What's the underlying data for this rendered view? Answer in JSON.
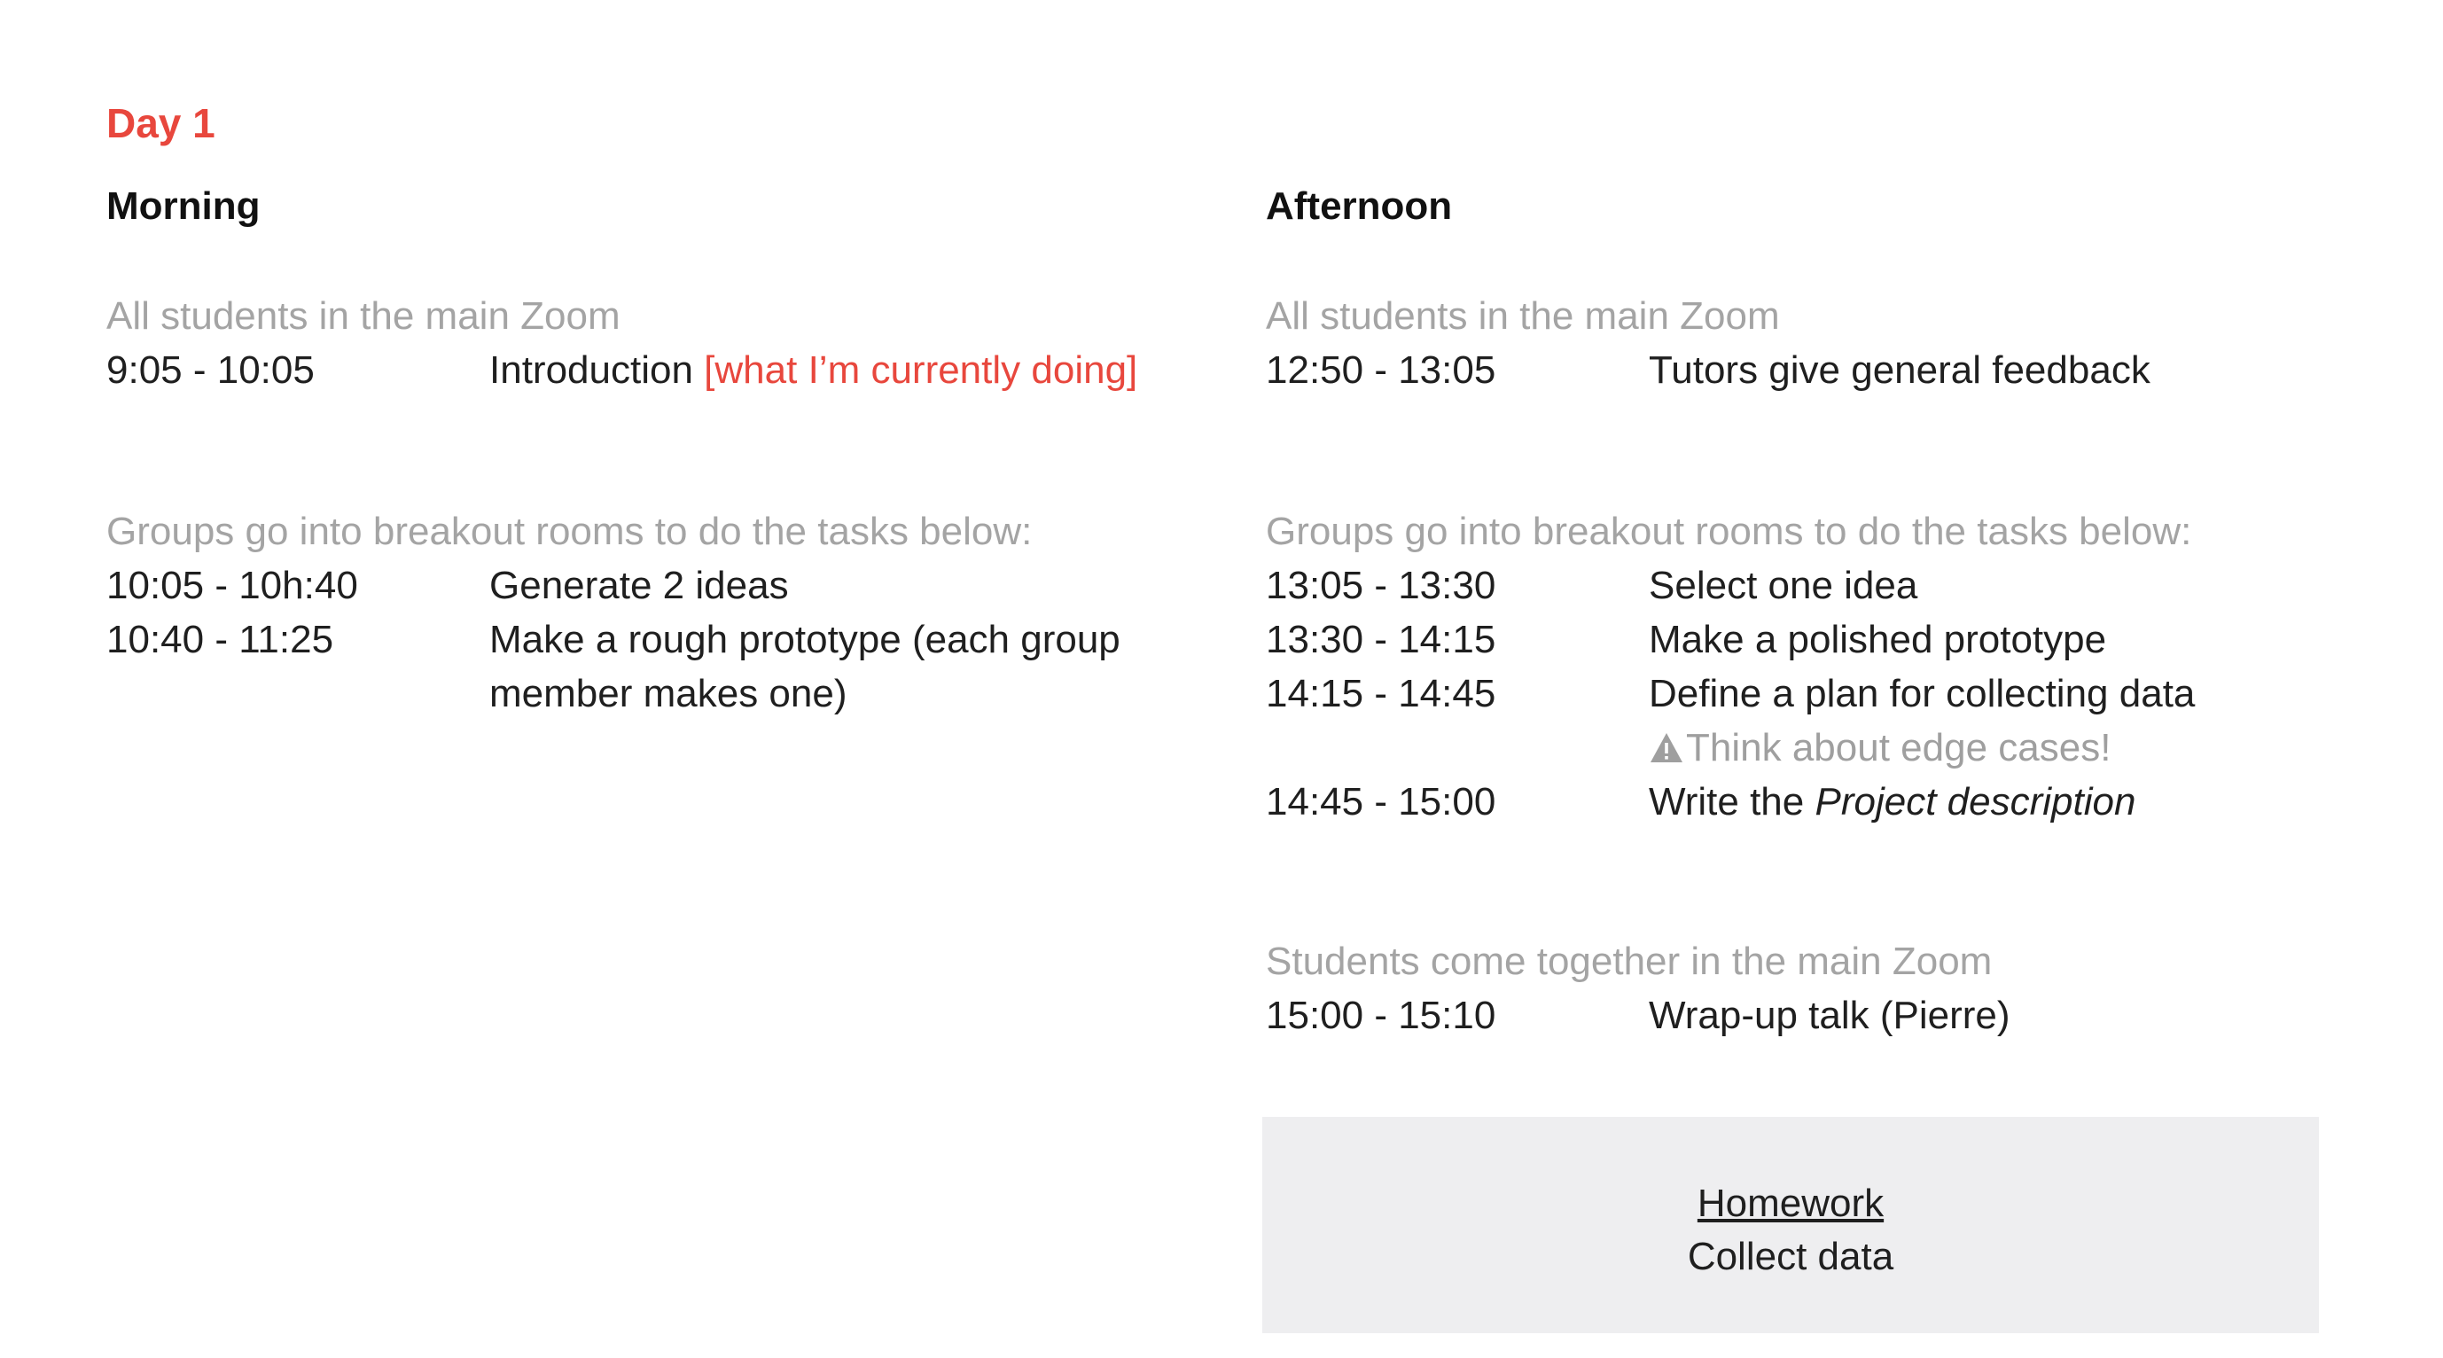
{
  "day_title": "Day 1",
  "morning": {
    "heading": "Morning",
    "sections": [
      {
        "note": "All students in the main Zoom",
        "rows": [
          {
            "time": "9:05 - 10:05",
            "task": "Introduction",
            "highlight": "[what I’m currently doing]"
          }
        ]
      },
      {
        "note": "Groups go into breakout rooms to do the tasks below:",
        "rows": [
          {
            "time": "10:05 - 10h:40",
            "task": "Generate 2 ideas"
          },
          {
            "time": "10:40 - 11:25",
            "task": "Make a rough prototype (each group member makes one)"
          }
        ]
      }
    ]
  },
  "afternoon": {
    "heading": "Afternoon",
    "sections": [
      {
        "note": "All students in the main Zoom",
        "rows": [
          {
            "time": "12:50 - 13:05",
            "task": "Tutors give general feedback"
          }
        ]
      },
      {
        "note": "Groups go into breakout rooms to do the tasks below:",
        "rows": [
          {
            "time": "13:05 - 13:30",
            "task": "Select one idea"
          },
          {
            "time": "13:30 - 14:15",
            "task": "Make a polished prototype"
          },
          {
            "time": "14:15 - 14:45",
            "task": "Define a plan for collecting data",
            "warning": "Think about edge cases!",
            "warning_icon": "warning-triangle-icon"
          },
          {
            "time": "14:45 - 15:00",
            "task_prefix": "Write the",
            "task_italic": "Project description"
          }
        ]
      },
      {
        "note": "Students come together in the main Zoom",
        "rows": [
          {
            "time": "15:00 - 15:10",
            "task": "Wrap-up talk (Pierre)"
          }
        ]
      }
    ]
  },
  "homework": {
    "title": "Homework",
    "body": "Collect data"
  },
  "colors": {
    "accent_red": "#e8473d",
    "note_gray": "#a4a4a4",
    "homework_bg": "#eeeef0"
  }
}
